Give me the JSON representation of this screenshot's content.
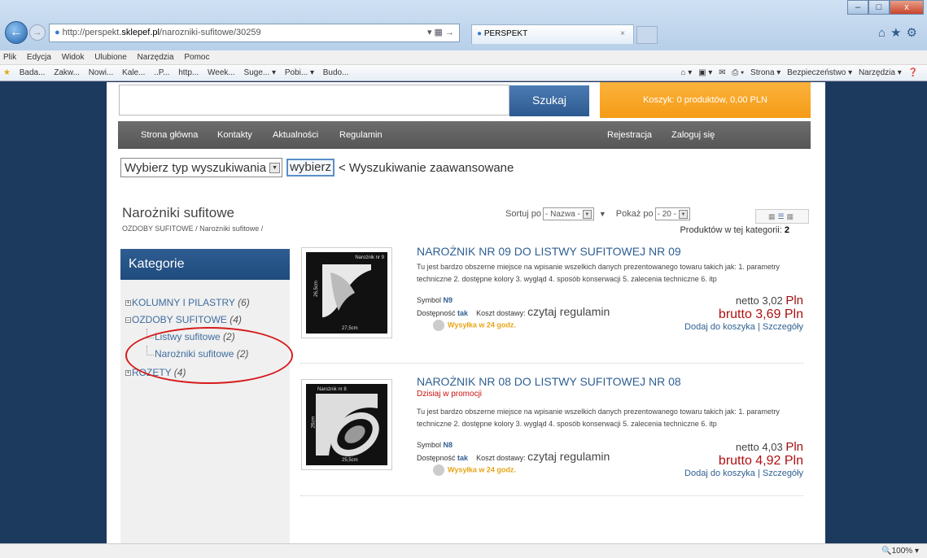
{
  "browser": {
    "url_prefix": "http://perspekt.",
    "url_domain": "sklepef.pl",
    "url_path": "/narozniki-sufitowe/30259",
    "tab_title": "PERSPEKT",
    "win_min": "–",
    "win_max": "□",
    "win_close": "x",
    "menu": [
      "Plik",
      "Edycja",
      "Widok",
      "Ulubione",
      "Narzędzia",
      "Pomoc"
    ],
    "favorites": [
      "Bada...",
      "Zakw...",
      "Nowi...",
      "Kale...",
      "..P...",
      "http...",
      "Week...",
      "Suge... ▾",
      "Pobi... ▾",
      "Budo..."
    ],
    "toolbar_right": [
      "Strona ▾",
      "Bezpieczeństwo ▾",
      "Narzędzia ▾"
    ],
    "zoom": "100%"
  },
  "header": {
    "search_button": "Szukaj",
    "cart": "Koszyk: 0 produktów, 0,00 PLN"
  },
  "nav": {
    "home": "Strona główna",
    "contact": "Kontakty",
    "news": "Aktualności",
    "terms": "Regulamin",
    "register": "Rejestracja",
    "login": "Zaloguj się"
  },
  "search": {
    "type_select": "Wybierz typ wyszukiwania",
    "choose_button": "wybierz",
    "advanced": "< Wyszukiwanie zaawansowane"
  },
  "category": {
    "name": "Narożniki sufitowe",
    "breadcrumb": "OZDOBY SUFITOWE / Narożniki sufitowe /",
    "sort_label": "Sortuj po",
    "sort_value": "- Nazwa -",
    "show_label": "Pokaż po",
    "show_value": "- 20 -",
    "count_label": "Produktów w tej kategorii:",
    "count_value": "2"
  },
  "sidebar": {
    "title": "Kategorie",
    "items": [
      {
        "label": "KOLUMNY I PILASTRY",
        "count": "(6)"
      },
      {
        "label": "OZDOBY SUFITOWE",
        "count": "(4)"
      },
      {
        "label": "Listwy sufitowe",
        "count": "(2)"
      },
      {
        "label": "Narożniki sufitowe",
        "count": "(2)"
      },
      {
        "label": "ROZETY",
        "count": "(4)"
      }
    ]
  },
  "products": [
    {
      "title": "NAROŻNIK NR 09 DO LISTWY SUFITOWEJ NR 09",
      "img_label": "Narożnik nr 9",
      "img_h": "26,5cm",
      "img_w": "27,5cm",
      "description": "Tu jest bardzo obszerne miejsce na wpisanie wszelkich danych prezentowanego towaru takich jak: 1. parametry techniczne 2. dostępne kolory 3. wygląd 4. sposób konserwacji 5. zalecenia techniczne 6. itp",
      "symbol_label": "Symbol",
      "symbol": "N9",
      "availability_label": "Dostępność",
      "availability": "tak",
      "shipping_label": "Koszt dostawy:",
      "shipping": "czytaj regulamin",
      "dispatch": "Wysyłka w 24 godz.",
      "netto": "netto 3,02",
      "netto_cur": "Pln",
      "brutto": "brutto 3,69 Pln",
      "add_to_cart": "Dodaj do koszyka",
      "separator": "|",
      "details": "Szczegóły"
    },
    {
      "title": "NAROŻNIK NR 08 DO LISTWY SUFITOWEJ NR 08",
      "promo": "Dzisiaj w promocji",
      "img_label": "Narożnik nr 8",
      "img_h": "26cm",
      "img_w": "25,5cm",
      "description": "Tu jest bardzo obszerne miejsce na wpisanie wszelkich danych prezentowanego towaru takich jak: 1. parametry techniczne 2. dostępne kolory 3. wygląd 4. sposób konserwacji 5. zalecenia techniczne 6. itp",
      "symbol_label": "Symbol",
      "symbol": "N8",
      "availability_label": "Dostępność",
      "availability": "tak",
      "shipping_label": "Koszt dostawy:",
      "shipping": "czytaj regulamin",
      "dispatch": "Wysyłka w 24 godz.",
      "netto": "netto 4,03",
      "netto_cur": "Pln",
      "brutto": "brutto 4,92 Pln",
      "add_to_cart": "Dodaj do koszyka",
      "separator": "|",
      "details": "Szczegóły"
    }
  ]
}
